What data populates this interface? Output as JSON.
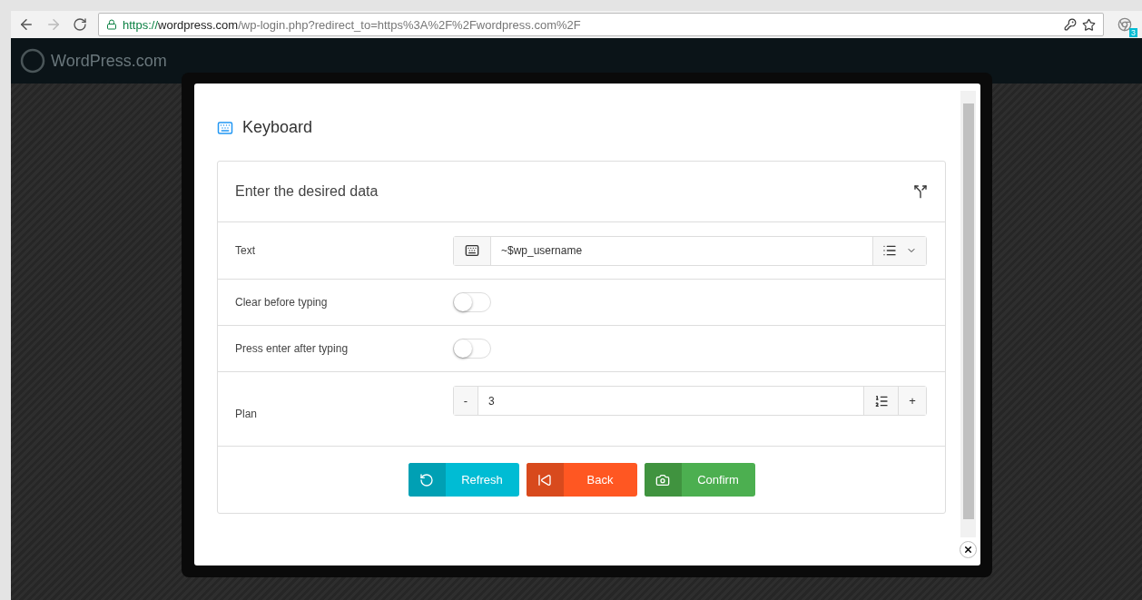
{
  "browser": {
    "url_scheme": "https://",
    "url_host": "wordpress.com",
    "url_path": "/wp-login.php?redirect_to=https%3A%2F%2Fwordpress.com%2F",
    "extension_badge": "3"
  },
  "site": {
    "logo_text": "WordPress.com"
  },
  "dialog": {
    "title": "Keyboard",
    "card_title": "Enter the desired data",
    "fields": [
      {
        "kind": "text",
        "label": "Text",
        "value": "~$wp_username"
      },
      {
        "kind": "toggle",
        "label": "Clear before typing",
        "on": false
      },
      {
        "kind": "toggle",
        "label": "Press enter after typing",
        "on": false
      },
      {
        "kind": "stepper",
        "label": "Plan",
        "value": "3",
        "minus": "-",
        "plus": "+"
      }
    ],
    "buttons": [
      {
        "kind": "refresh",
        "label": "Refresh"
      },
      {
        "kind": "back",
        "label": "Back"
      },
      {
        "kind": "confirm",
        "label": "Confirm"
      }
    ]
  }
}
